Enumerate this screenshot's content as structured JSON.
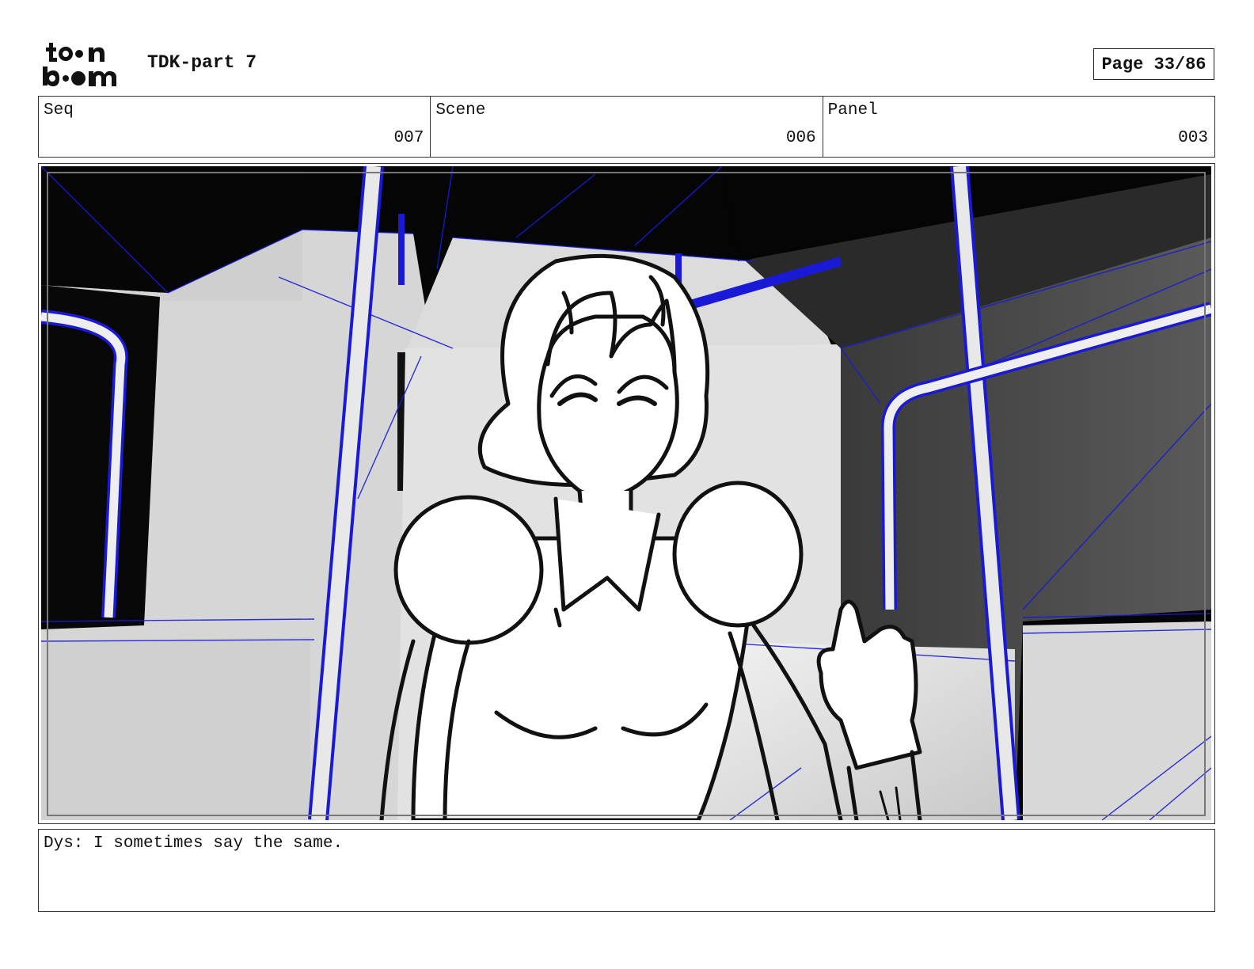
{
  "header": {
    "logo_top": "toon",
    "logo_bottom": "boom",
    "title": "TDK-part 7",
    "page_label": "Page 33/86"
  },
  "info": {
    "seq_label": "Seq",
    "seq_value": "007",
    "scene_label": "Scene",
    "scene_value": "006",
    "panel_label": "Panel",
    "panel_value": "003"
  },
  "dialogue": {
    "text": "Dys: I sometimes say the same."
  },
  "colors": {
    "wireframe": "#1a1ad6",
    "ink": "#111111"
  }
}
